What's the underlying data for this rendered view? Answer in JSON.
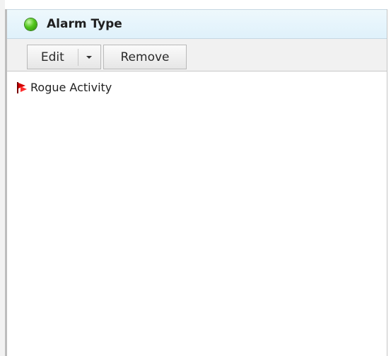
{
  "panel": {
    "title": "Alarm Type",
    "status_icon": "green-status-dot",
    "status_color": "#52c71d"
  },
  "toolbar": {
    "edit_label": "Edit",
    "dropdown_icon": "chevron-down-icon",
    "remove_label": "Remove"
  },
  "list": {
    "items": [
      {
        "label": "Rogue Activity",
        "icon": "red-flag-icon"
      }
    ]
  }
}
